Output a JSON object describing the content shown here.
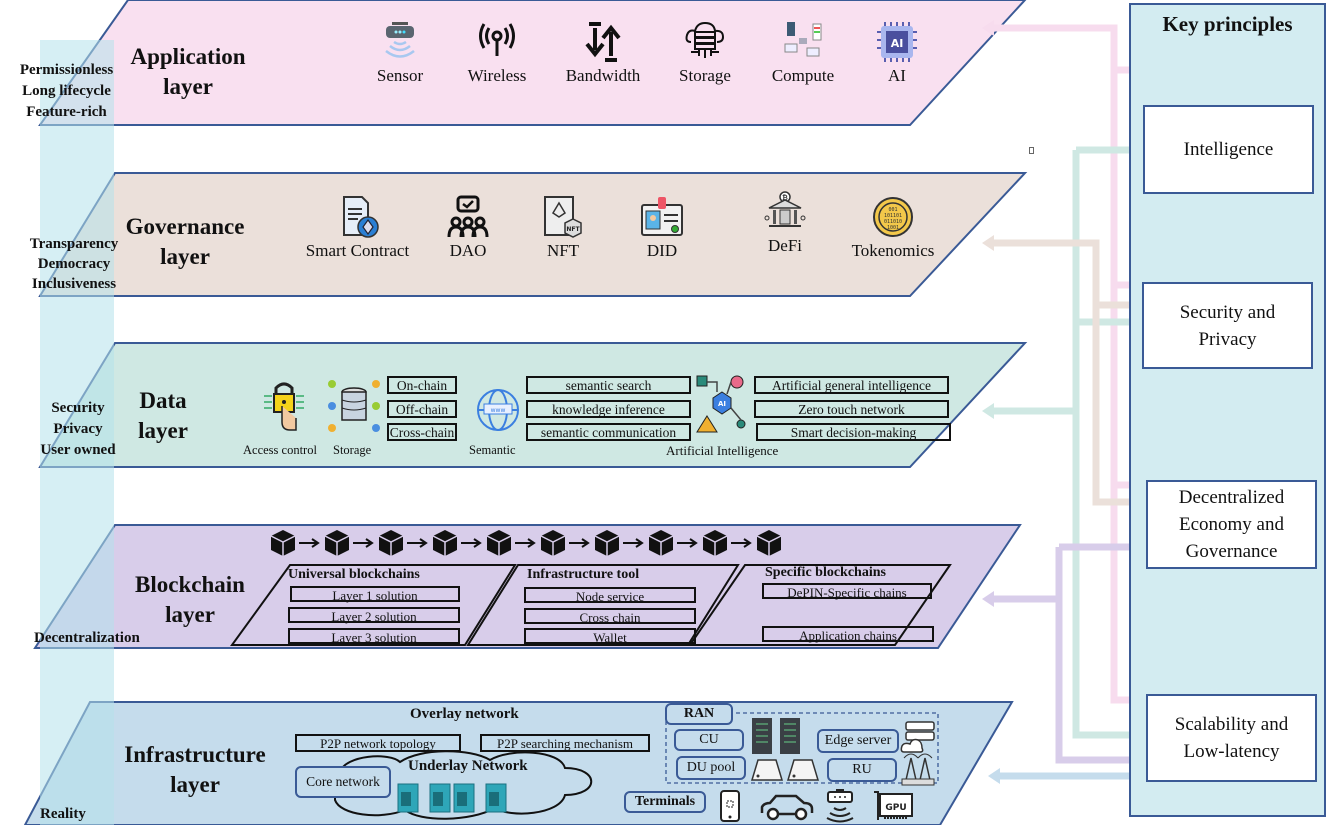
{
  "layers": [
    {
      "id": "application",
      "title_line1": "Application",
      "title_line2": "layer",
      "fill": "#f9e0f0",
      "properties": [
        "Permissionless",
        "Long lifecycle",
        "Feature-rich"
      ],
      "items": [
        {
          "label": "Sensor",
          "icon": "sensor-icon"
        },
        {
          "label": "Wireless",
          "icon": "wireless-icon"
        },
        {
          "label": "Bandwidth",
          "icon": "bandwidth-icon"
        },
        {
          "label": "Storage",
          "icon": "cloud-storage-icon"
        },
        {
          "label": "Compute",
          "icon": "compute-icon"
        },
        {
          "label": "AI",
          "icon": "ai-chip-icon"
        }
      ]
    },
    {
      "id": "governance",
      "title_line1": "Governance",
      "title_line2": "layer",
      "fill": "#ebe0da",
      "properties": [
        "Transparency",
        "Democracy",
        "Inclusiveness"
      ],
      "items": [
        {
          "label": "Smart Contract",
          "icon": "smart-contract-icon"
        },
        {
          "label": "DAO",
          "icon": "dao-icon"
        },
        {
          "label": "NFT",
          "icon": "nft-icon"
        },
        {
          "label": "DID",
          "icon": "did-card-icon"
        },
        {
          "label": "DeFi",
          "icon": "defi-bank-icon"
        },
        {
          "label": "Tokenomics",
          "icon": "token-coin-icon"
        }
      ]
    },
    {
      "id": "data",
      "title_line1": "Data",
      "title_line2": "layer",
      "fill": "#cfe8e3",
      "properties": [
        "Security",
        "Privacy",
        "User owned"
      ],
      "access_control": "Access control",
      "storage": "Storage",
      "storage_types": [
        "On-chain",
        "Off-chain",
        "Cross-chain"
      ],
      "semantic": "Semantic",
      "semantic_items": [
        "semantic search",
        "knowledge inference",
        "semantic communication"
      ],
      "ai": "Artificial Intelligence",
      "ai_items": [
        "Artificial general intelligence",
        "Zero touch network",
        "Smart decision-making"
      ]
    },
    {
      "id": "blockchain",
      "title_line1": "Blockchain",
      "title_line2": "layer",
      "fill": "#d8cdea",
      "properties": [
        "Decentralization"
      ],
      "groups": [
        {
          "title": "Universal blockchains",
          "items": [
            "Layer 1 solution",
            "Layer 2 solution",
            "Layer 3 solution"
          ]
        },
        {
          "title": "Infrastructure tool",
          "items": [
            "Node service",
            "Cross chain",
            "Wallet"
          ]
        },
        {
          "title": "Specific blockchains",
          "items": [
            "DePIN-Specific chains",
            "Application chains"
          ]
        }
      ],
      "block_count": 10
    },
    {
      "id": "infrastructure",
      "title_line1": "Infrastructure",
      "title_line2": "layer",
      "fill": "#c5dcec",
      "properties": [
        "Reality"
      ],
      "overlay_title": "Overlay network",
      "overlay_items": [
        "P2P network topology",
        "P2P searching mechanism"
      ],
      "underlay_title": "Underlay Network",
      "core_network": "Core network",
      "ran": {
        "title": "RAN",
        "cu": "CU",
        "du_pool": "DU pool",
        "edge_server": "Edge server",
        "ru": "RU"
      },
      "terminals": "Terminals",
      "gpu": "GPU"
    }
  ],
  "key_principles": {
    "title": "Key principles",
    "items": [
      {
        "line1": "Intelligence",
        "line2": "",
        "line3": ""
      },
      {
        "line1": "Security and",
        "line2": "Privacy",
        "line3": ""
      },
      {
        "line1": "Decentralized",
        "line2": "Economy and",
        "line3": "Governance"
      },
      {
        "line1": "Scalability and",
        "line2": "Low-latency",
        "line3": ""
      }
    ]
  },
  "colors": {
    "border": "#3a5a96",
    "side_band": "#d5eef3",
    "pink_link": "#f7dcee",
    "beige_link": "#ebe0da",
    "green_link": "#cfe8e3",
    "purple_link": "#d8cdea",
    "blue_link": "#c5dcec"
  }
}
